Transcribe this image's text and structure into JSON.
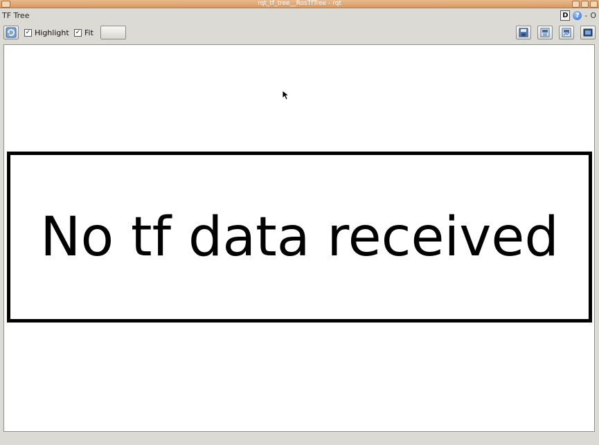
{
  "window": {
    "title": "rqt_tf_tree__RosTfTree - rqt"
  },
  "plugin": {
    "title": "TF Tree",
    "d_label": "D",
    "help_label": "?",
    "minus_label": "-",
    "o_label": "O"
  },
  "toolbar": {
    "highlight_label": "Highlight",
    "highlight_checked": true,
    "fit_label": "Fit",
    "fit_checked": true,
    "check_mark": "✓"
  },
  "canvas": {
    "message": "No tf data received"
  },
  "colors": {
    "titlebar": "#d79a63",
    "background": "#dcdad5",
    "canvas": "#ffffff",
    "message": "#000000"
  }
}
